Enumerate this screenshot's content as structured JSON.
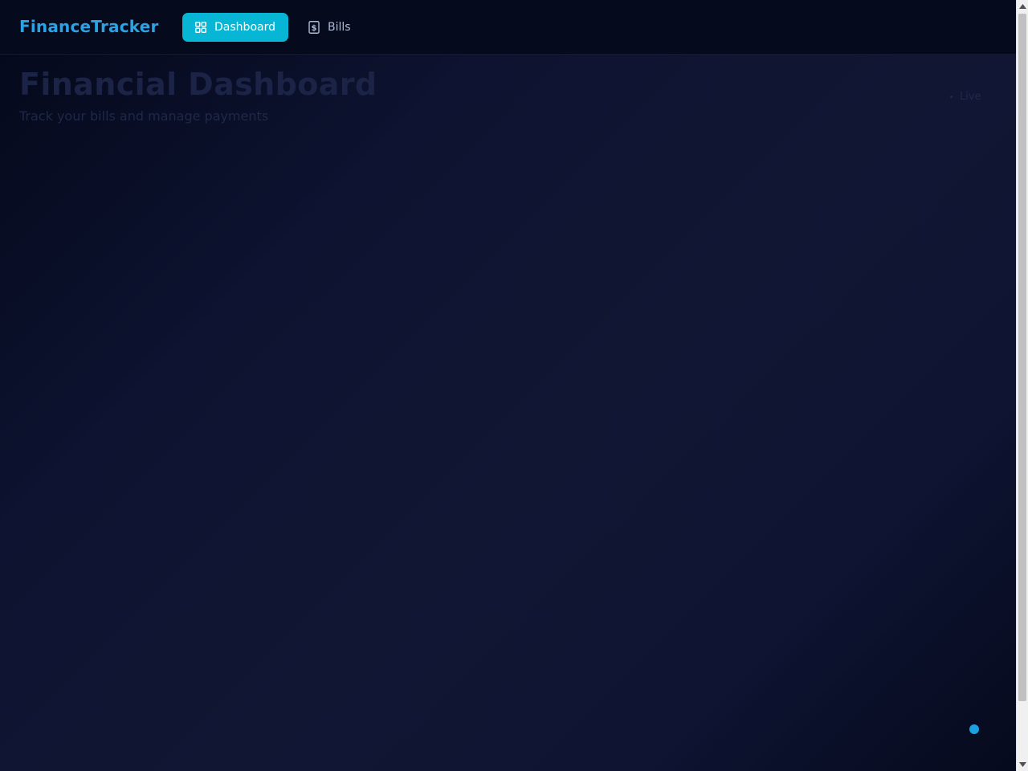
{
  "header": {
    "brand": "FinanceTracker",
    "nav": [
      {
        "label": "Dashboard",
        "icon": "dashboard-grid-icon",
        "active": true
      },
      {
        "label": "Bills",
        "icon": "dollar-receipt-icon",
        "active": false
      }
    ]
  },
  "main": {
    "title": "Financial Dashboard",
    "subtitle": "Track your bills and manage payments",
    "live_label": "Live"
  },
  "colors": {
    "accent": "#06b6d4",
    "brand": "#29a3e6",
    "background": "#0b1024",
    "header_bg": "#050a1c",
    "indicator_dot": "#1ba1e2"
  }
}
